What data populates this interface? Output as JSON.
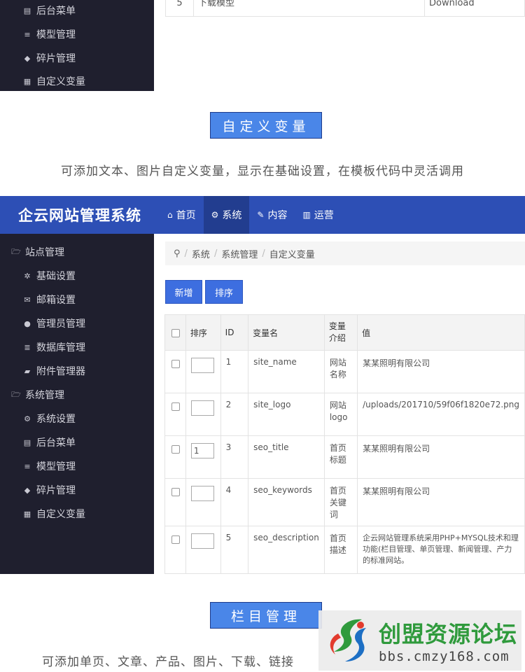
{
  "top_panel": {
    "sidebar": [
      {
        "icon": "menu-list-icon",
        "label": "后台菜单"
      },
      {
        "icon": "bars-icon",
        "label": "模型管理"
      },
      {
        "icon": "tags-icon",
        "label": "碎片管理"
      },
      {
        "icon": "grid-icon",
        "label": "自定义变量"
      }
    ],
    "table_row": {
      "num": "5",
      "name": "下载模型",
      "value": "Download"
    }
  },
  "section1": {
    "title": "自定义变量",
    "desc": "可添加文本、图片自定义变量，显示在基础设置，在模板代码中灵活调用"
  },
  "app": {
    "brand": "企云网站管理系统",
    "nav": [
      {
        "icon": "home-icon",
        "label": "首页"
      },
      {
        "icon": "cogs-icon",
        "label": "系统"
      },
      {
        "icon": "edit-icon",
        "label": "内容"
      },
      {
        "icon": "bar-chart-icon",
        "label": "运营"
      }
    ],
    "sidebar": {
      "group1": "站点管理",
      "group1_items": [
        "基础设置",
        "邮箱设置",
        "管理员管理",
        "数据库管理",
        "附件管理器"
      ],
      "group2": "系统管理",
      "group2_items": [
        "系统设置",
        "后台菜单",
        "模型管理",
        "碎片管理",
        "自定义变量"
      ]
    },
    "breadcrumb": [
      "系统",
      "系统管理",
      "自定义变量"
    ],
    "buttons": {
      "add": "新增",
      "sort": "排序"
    },
    "table": {
      "headers": {
        "sort": "排序",
        "id": "ID",
        "name": "变量名",
        "intro": "变量介绍",
        "value": "值"
      },
      "rows": [
        {
          "sort": "",
          "id": "1",
          "name": "site_name",
          "intro": "网站名称",
          "value": "某某照明有限公司"
        },
        {
          "sort": "",
          "id": "2",
          "name": "site_logo",
          "intro": "网站logo",
          "value": "/uploads/201710/59f06f1820e72.png"
        },
        {
          "sort": "1",
          "id": "3",
          "name": "seo_title",
          "intro": "首页标题",
          "value": "某某照明有限公司"
        },
        {
          "sort": "",
          "id": "4",
          "name": "seo_keywords",
          "intro": "首页关键词",
          "value": "某某照明有限公司"
        },
        {
          "sort": "",
          "id": "5",
          "name": "seo_description",
          "intro": "首页描述",
          "value": "企云网站管理系统采用PHP+MYSQL技术和理功能(栏目管理、单页管理、新闻管理、产力的标准网站。"
        }
      ]
    }
  },
  "section2": {
    "title": "栏目管理",
    "desc": "可添加单页、文章、产品、图片、下载、链接"
  },
  "watermark": {
    "title": "创盟资源论坛",
    "url": "bbs.cmzy168.com"
  }
}
